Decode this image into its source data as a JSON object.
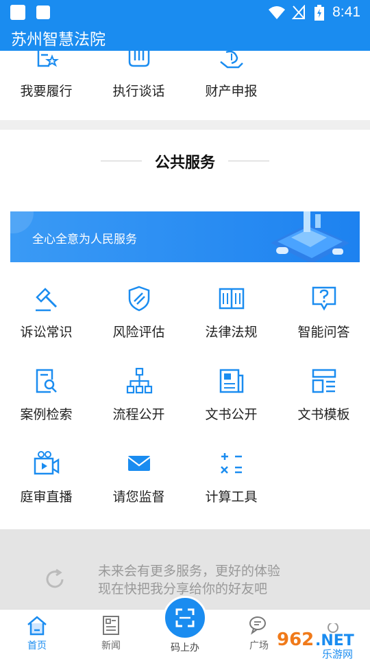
{
  "status_bar": {
    "time": "8:41"
  },
  "header": {
    "title": "苏州智慧法院"
  },
  "top_items": [
    {
      "label": "我要履行",
      "icon": "document-star-icon"
    },
    {
      "label": "执行谈话",
      "icon": "microphone-icon"
    },
    {
      "label": "财产申报",
      "icon": "money-hand-icon"
    }
  ],
  "public_services": {
    "title": "公共服务",
    "banner_text": "全心全意为人民服务",
    "items": [
      {
        "label": "诉讼常识",
        "icon": "gavel-icon"
      },
      {
        "label": "风险评估",
        "icon": "shield-icon"
      },
      {
        "label": "法律法规",
        "icon": "book-icon"
      },
      {
        "label": "智能问答",
        "icon": "question-bubble-icon"
      },
      {
        "label": "案例检索",
        "icon": "document-search-icon"
      },
      {
        "label": "流程公开",
        "icon": "flowchart-icon"
      },
      {
        "label": "文书公开",
        "icon": "newspaper-icon"
      },
      {
        "label": "文书模板",
        "icon": "template-icon"
      },
      {
        "label": "庭审直播",
        "icon": "video-camera-icon"
      },
      {
        "label": "请您监督",
        "icon": "envelope-icon"
      },
      {
        "label": "计算工具",
        "icon": "calculator-icon"
      }
    ]
  },
  "more": {
    "line1": "未来会有更多服务，更好的体验",
    "line2": "现在快把我分享给你的好友吧"
  },
  "bottom_nav": [
    {
      "label": "首页",
      "icon": "home-icon",
      "active": true
    },
    {
      "label": "新闻",
      "icon": "news-icon",
      "active": false
    },
    {
      "label": "码上办",
      "icon": "scan-icon",
      "active": false
    },
    {
      "label": "广场",
      "icon": "chat-icon",
      "active": false
    }
  ],
  "watermark": {
    "text": "962.NET",
    "sub": "乐游网"
  },
  "colors": {
    "primary": "#1a8cf0",
    "text": "#222222",
    "muted": "#999999"
  }
}
